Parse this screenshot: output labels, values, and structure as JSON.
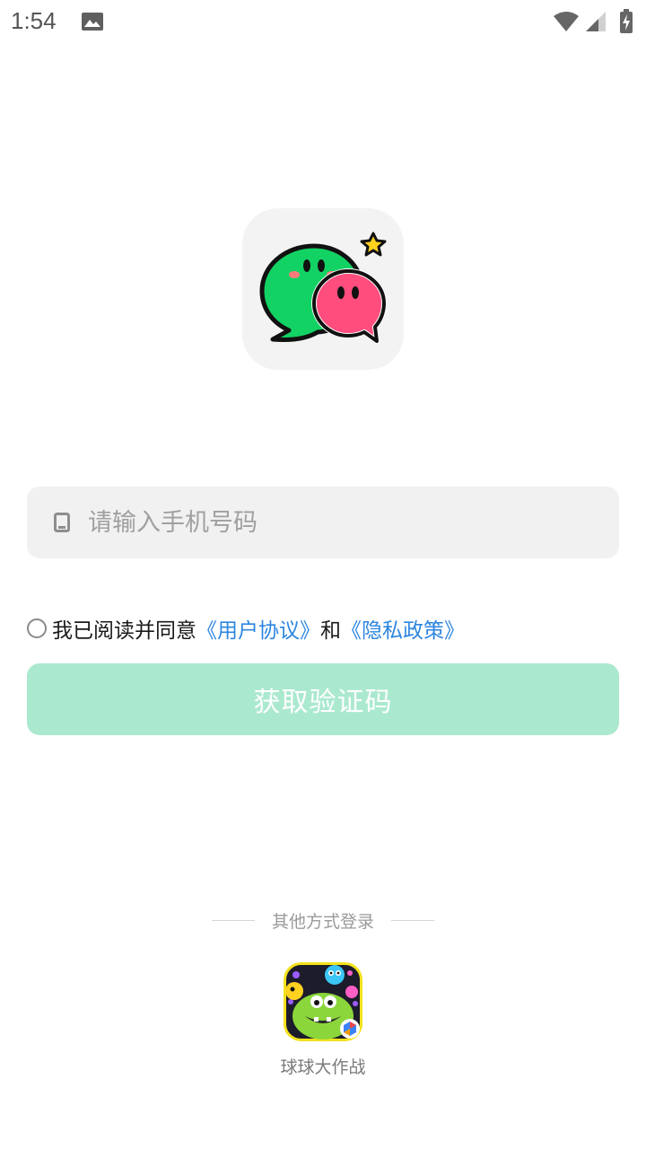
{
  "status_bar": {
    "time": "1:54",
    "icons": [
      "photo-icon",
      "wifi-icon",
      "signal-icon",
      "battery-icon"
    ]
  },
  "logo": {
    "icon": "chat-bubbles-logo"
  },
  "phone_input": {
    "icon": "phone-icon",
    "placeholder": "请输入手机号码",
    "value": ""
  },
  "agreement": {
    "checked": false,
    "prefix": "我已阅读并同意",
    "user_agreement": "《用户协议》",
    "conjunction": "和",
    "privacy_policy": "《隐私政策》"
  },
  "get_code_button": {
    "label": "获取验证码",
    "enabled": false
  },
  "other_login": {
    "title": "其他方式登录",
    "options": [
      {
        "label": "球球大作战",
        "icon": "ball-battle-game-icon"
      }
    ]
  },
  "colors": {
    "accent_button": "#abe9cf",
    "link": "#2d86e0",
    "input_bg": "#f1f1f1",
    "logo_green": "#12d264",
    "logo_pink": "#ff4d7d"
  }
}
